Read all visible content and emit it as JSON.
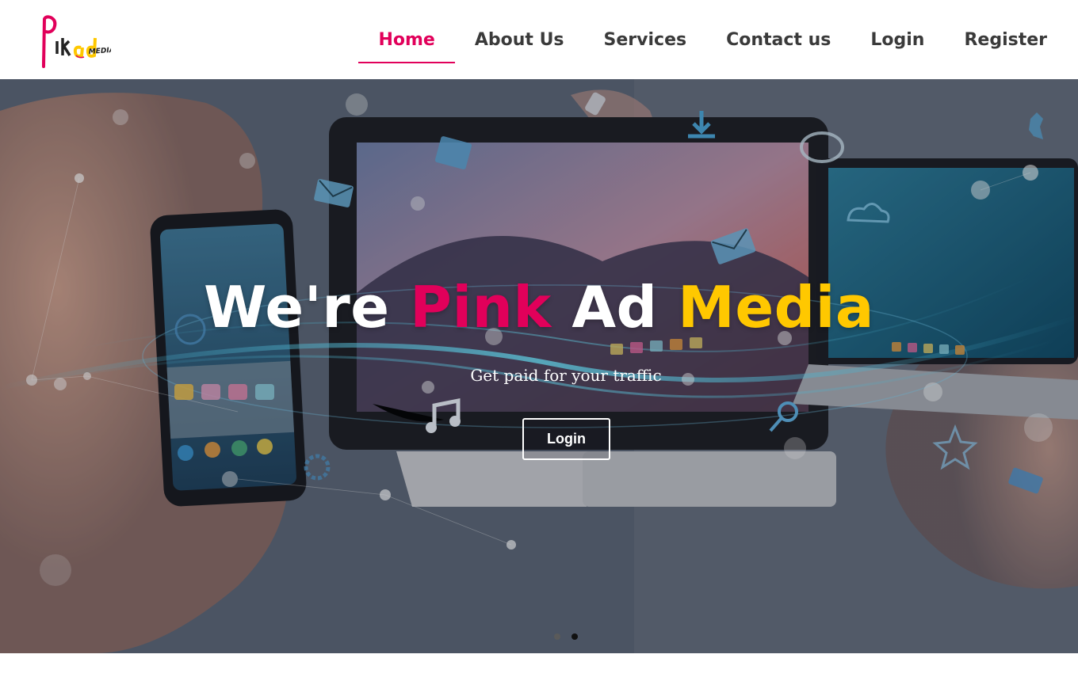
{
  "brand": {
    "logo_text": "Pink ad MEDIA",
    "colors": {
      "pink": "#e1005a",
      "yellow": "#ffc800",
      "nav_text": "#3a3a3a"
    }
  },
  "nav": {
    "items": [
      {
        "label": "Home",
        "active": true
      },
      {
        "label": "About Us",
        "active": false
      },
      {
        "label": "Services",
        "active": false
      },
      {
        "label": "Contact us",
        "active": false
      },
      {
        "label": "Login",
        "active": false
      },
      {
        "label": "Register",
        "active": false
      }
    ]
  },
  "hero": {
    "title_part1": "We're ",
    "title_part2": "Pink",
    "title_part3": " Ad ",
    "title_part4": "Media",
    "subtitle": "Get paid for your traffic",
    "button_label": "Login",
    "background_icons": [
      "smartphone-icon",
      "monitor-icon",
      "laptop-icon",
      "envelope-icon",
      "calendar-icon",
      "music-note-icon",
      "star-icon",
      "search-icon",
      "chat-bubble-icon",
      "download-icon",
      "cloud-icon",
      "gear-icon"
    ],
    "carousel": {
      "slide_count": 2,
      "active_index": 2
    }
  }
}
